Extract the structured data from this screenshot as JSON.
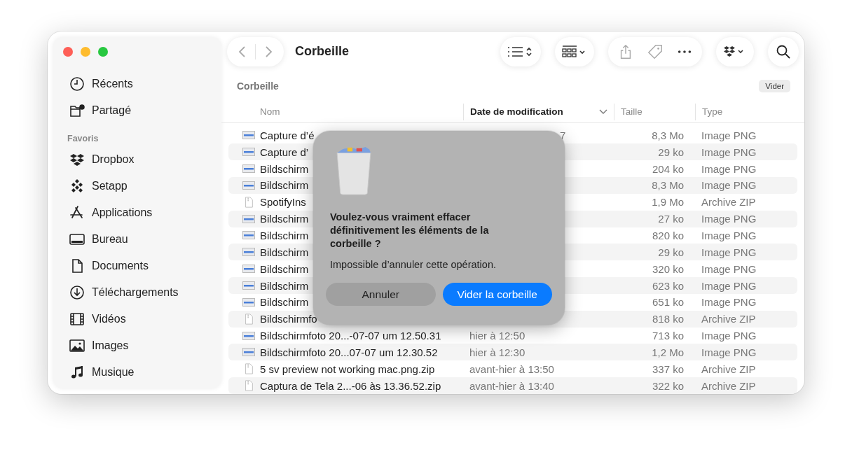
{
  "window": {
    "title": "Corbeille"
  },
  "sidebar": {
    "items": [
      {
        "label": "Récents",
        "kind": "clock",
        "selected": false
      },
      {
        "label": "Partagé",
        "kind": "shared",
        "selected": false
      }
    ],
    "sections": [
      {
        "heading": "Favoris",
        "items": [
          {
            "label": "Dropbox",
            "kind": "dropbox",
            "selected": false
          },
          {
            "label": "Setapp",
            "kind": "setapp",
            "selected": false
          },
          {
            "label": "Applications",
            "kind": "apps",
            "selected": false
          },
          {
            "label": "Bureau",
            "kind": "desktop",
            "selected": false
          },
          {
            "label": "Documents",
            "kind": "document",
            "selected": false
          },
          {
            "label": "Téléchargements",
            "kind": "download",
            "selected": false
          },
          {
            "label": "Vidéos",
            "kind": "film",
            "selected": false
          },
          {
            "label": "Images",
            "kind": "photo",
            "selected": false
          },
          {
            "label": "Musique",
            "kind": "music",
            "selected": false
          }
        ]
      }
    ]
  },
  "location": {
    "title": "Corbeille",
    "empty_button": "Vider"
  },
  "table": {
    "columns": [
      {
        "label": "Nom",
        "sorted": false
      },
      {
        "label": "Date de modification",
        "sorted": true
      },
      {
        "label": "Taille",
        "sorted": false
      },
      {
        "label": "Type",
        "sorted": false
      }
    ],
    "rows": [
      {
        "kind": "image",
        "name": "Capture d’é",
        "date": "7",
        "date_cut": true,
        "size": "8,3 Mo",
        "type": "Image PNG"
      },
      {
        "kind": "image",
        "name": "Capture d’",
        "size": "29 ko",
        "type": "Image PNG"
      },
      {
        "kind": "image",
        "name": "Bildschirm",
        "size": "204 ko",
        "type": "Image PNG"
      },
      {
        "kind": "image",
        "name": "Bildschirm",
        "size": "8,3 Mo",
        "type": "Image PNG"
      },
      {
        "kind": "archive",
        "name": "SpotifyIns",
        "size": "1,9 Mo",
        "type": "Archive ZIP"
      },
      {
        "kind": "image",
        "name": "Bildschirm",
        "size": "27 ko",
        "type": "Image PNG"
      },
      {
        "kind": "image",
        "name": "Bildschirm",
        "size": "820 ko",
        "type": "Image PNG"
      },
      {
        "kind": "image",
        "name": "Bildschirm",
        "size": "29 ko",
        "type": "Image PNG"
      },
      {
        "kind": "image",
        "name": "Bildschirm",
        "size": "320 ko",
        "type": "Image PNG"
      },
      {
        "kind": "image",
        "name": "Bildschirm",
        "size": "623 ko",
        "type": "Image PNG"
      },
      {
        "kind": "image",
        "name": "Bildschirm",
        "size": "651 ko",
        "type": "Image PNG"
      },
      {
        "kind": "archive",
        "name": "Bildschirmfo",
        "size": "818 ko",
        "type": "Archive ZIP"
      },
      {
        "kind": "image",
        "name": "Bildschirmfoto 20...-07-07 um 12.50.31",
        "date": "hier à 12:50",
        "size": "713 ko",
        "type": "Image PNG"
      },
      {
        "kind": "image",
        "name": "Bildschirmfoto 20...07-07 um 12.30.52",
        "date": "hier à 12:30",
        "size": "1,2 Mo",
        "type": "Image PNG"
      },
      {
        "kind": "archive",
        "name": "5 sv preview not working mac.png.zip",
        "date": "avant-hier à 13:50",
        "size": "337 ko",
        "type": "Archive ZIP"
      },
      {
        "kind": "archive",
        "name": "Captura de Tela 2...-06 às 13.36.52.zip",
        "date": "avant-hier à 13:40",
        "size": "322 ko",
        "type": "Archive ZIP"
      }
    ]
  },
  "dialog": {
    "message": "Voulez-vous vraiment effacer définitivement les éléments de la corbeille ?",
    "detail": "Impossible d’annuler cette opération.",
    "buttons": [
      {
        "label": "Annuler",
        "kind": "cancel"
      },
      {
        "label": "Vider la corbeille",
        "kind": "default"
      }
    ]
  }
}
